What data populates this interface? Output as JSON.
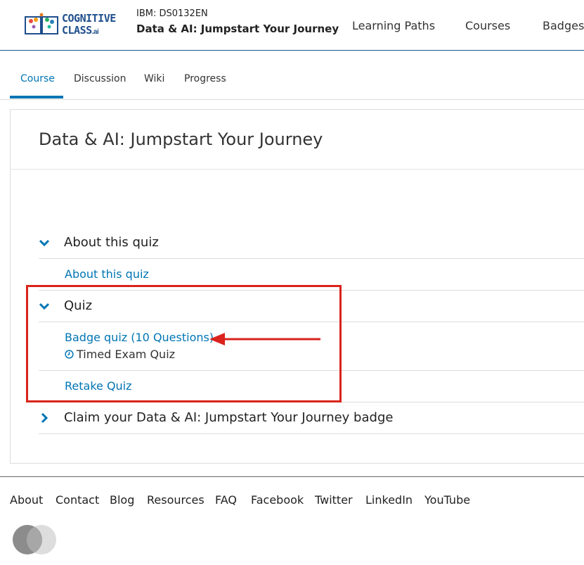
{
  "header": {
    "logo": {
      "line1": "COGNITIVE",
      "line2": "CLASS",
      "suffix": ".ai"
    },
    "course_code": "IBM: DS0132EN",
    "course_name": "Data & AI: Jumpstart Your Journey",
    "nav": [
      "Learning Paths",
      "Courses",
      "Badges"
    ]
  },
  "tabs": {
    "items": [
      "Course",
      "Discussion",
      "Wiki",
      "Progress"
    ],
    "active": "Course"
  },
  "main": {
    "title": "Data & AI: Jumpstart Your Journey",
    "sections": [
      {
        "label": "About this quiz",
        "expanded": true,
        "links": [
          {
            "label": "About this quiz"
          }
        ]
      },
      {
        "label": "Quiz",
        "expanded": true,
        "links": [
          {
            "label": "Badge quiz (10 Questions)",
            "note": "Timed Exam Quiz"
          },
          {
            "label": "Retake Quiz"
          }
        ]
      },
      {
        "label": "Claim your Data & AI: Jumpstart Your Journey badge",
        "expanded": false,
        "links": []
      }
    ]
  },
  "footer": {
    "links": [
      "About",
      "Contact",
      "Blog",
      "Resources",
      "FAQ",
      "Facebook",
      "Twitter",
      "LinkedIn",
      "YouTube"
    ]
  },
  "icons": {
    "chevron_down": "chevron-down-icon",
    "chevron_right": "chevron-right-icon",
    "clock": "clock-icon",
    "annotation_arrow": "arrow-left-icon"
  },
  "colors": {
    "link": "#0075b4",
    "annotation": "#d9231c",
    "brand": "#1e4e8c"
  }
}
